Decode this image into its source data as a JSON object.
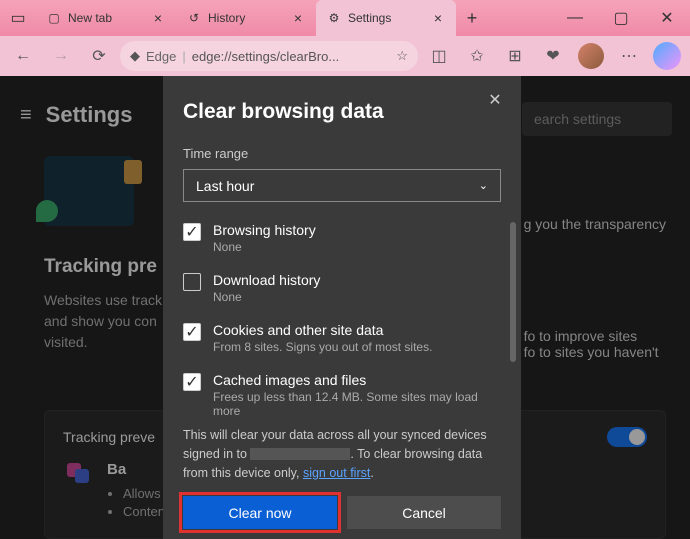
{
  "window": {
    "tabs": [
      {
        "title": "New tab",
        "icon": "tab"
      },
      {
        "title": "History",
        "icon": "history"
      },
      {
        "title": "Settings",
        "icon": "gear",
        "active": true
      }
    ]
  },
  "address": {
    "edge_label": "Edge",
    "url": "edge://settings/clearBro..."
  },
  "settings": {
    "heading": "Settings",
    "search_placeholder": "earch settings",
    "transparency": "g you the transparency",
    "tracking_heading": "Tracking pre",
    "tracking_desc_parts": [
      "Websites use track",
      "fo to improve sites",
      "and show you con",
      "fo to sites you haven't",
      "visited."
    ],
    "card": {
      "label": "Tracking preve",
      "title": "Ba",
      "bullets": [
        "Allows mos",
        "Content and"
      ]
    }
  },
  "dialog": {
    "title": "Clear browsing data",
    "time_label": "Time range",
    "time_value": "Last hour",
    "items": [
      {
        "checked": true,
        "title": "Browsing history",
        "sub": "None"
      },
      {
        "checked": false,
        "title": "Download history",
        "sub": "None"
      },
      {
        "checked": true,
        "title": "Cookies and other site data",
        "sub": "From 8 sites. Signs you out of most sites."
      },
      {
        "checked": true,
        "title": "Cached images and files",
        "sub": "Frees up less than 12.4 MB. Some sites may load more"
      }
    ],
    "sync_note_pre": "This will clear your data across all your synced devices signed in to ",
    "sync_note_mid": ". To clear browsing data from this device only, ",
    "sign_out": "sign out first",
    "clear_btn": "Clear now",
    "cancel_btn": "Cancel"
  }
}
